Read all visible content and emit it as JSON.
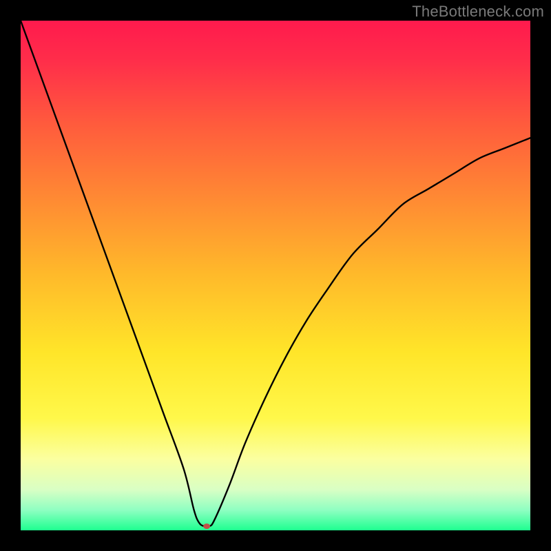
{
  "watermark": "TheBottleneck.com",
  "chart_data": {
    "type": "line",
    "title": "",
    "xlabel": "",
    "ylabel": "",
    "xlim": [
      0,
      100
    ],
    "ylim": [
      0,
      100
    ],
    "background_gradient_stops": [
      {
        "offset": 0.0,
        "color": "#ff1a4d"
      },
      {
        "offset": 0.08,
        "color": "#ff2e4a"
      },
      {
        "offset": 0.2,
        "color": "#ff5a3d"
      },
      {
        "offset": 0.35,
        "color": "#ff8a33"
      },
      {
        "offset": 0.5,
        "color": "#ffba2a"
      },
      {
        "offset": 0.65,
        "color": "#ffe529"
      },
      {
        "offset": 0.78,
        "color": "#fff84a"
      },
      {
        "offset": 0.86,
        "color": "#fbffa0"
      },
      {
        "offset": 0.92,
        "color": "#d9ffc4"
      },
      {
        "offset": 0.96,
        "color": "#8fffc2"
      },
      {
        "offset": 1.0,
        "color": "#1eff90"
      }
    ],
    "curve": {
      "x": [
        0,
        4,
        8,
        12,
        16,
        20,
        24,
        28,
        32,
        34,
        35,
        36,
        37,
        38,
        41,
        44,
        48,
        52,
        56,
        60,
        65,
        70,
        75,
        80,
        85,
        90,
        95,
        100
      ],
      "y": [
        100,
        89,
        78,
        67,
        56,
        45,
        34,
        23,
        12,
        4,
        1.5,
        0.8,
        0.8,
        2,
        9,
        17,
        26,
        34,
        41,
        47,
        54,
        59,
        64,
        67,
        70,
        73,
        75,
        77
      ]
    },
    "minimum_marker": {
      "x": 36.5,
      "y": 0.8,
      "color": "#c05048",
      "rx": 5,
      "ry": 4
    },
    "minimum_plateau": {
      "x_start": 33.5,
      "x_end": 38,
      "y": 0.8
    }
  }
}
